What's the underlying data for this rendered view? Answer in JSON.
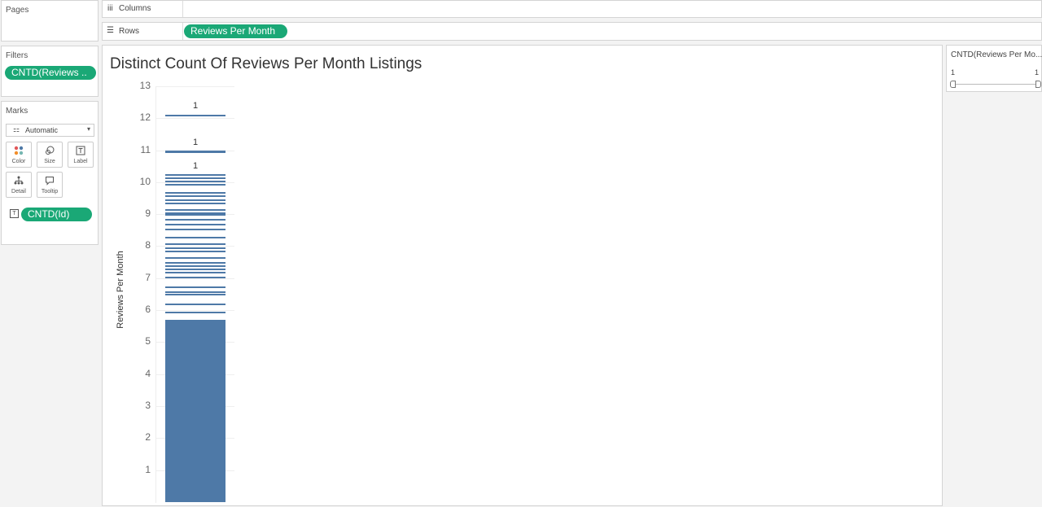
{
  "pages": {
    "title": "Pages"
  },
  "columns": {
    "icon": "iii",
    "label": "Columns"
  },
  "rows": {
    "icon": "☰",
    "label": "Rows",
    "pill": "Reviews Per Month"
  },
  "filters": {
    "title": "Filters",
    "pill": "CNTD(Reviews .."
  },
  "marks": {
    "title": "Marks",
    "dropdown": "Automatic",
    "buttons": [
      {
        "label": "Color",
        "icon": "color-icon"
      },
      {
        "label": "Size",
        "icon": "size-icon"
      },
      {
        "label": "Label",
        "icon": "label-icon"
      },
      {
        "label": "Detail",
        "icon": "detail-icon"
      },
      {
        "label": "Tooltip",
        "icon": "tooltip-icon"
      }
    ],
    "label_pill": "CNTD(Id)"
  },
  "legend": {
    "title": "CNTD(Reviews Per Mo...",
    "min": "1",
    "max": "1"
  },
  "colors": {
    "bar": "#4e79a7",
    "pill": "#1aa876"
  },
  "chart_data": {
    "type": "bar",
    "title": "Distinct Count Of Reviews Per Month Listings",
    "ylabel": "Reviews Per Month",
    "xlabel": "",
    "ylim": [
      0,
      13.2
    ],
    "yticks": [
      "1",
      "2",
      "3",
      "4",
      "5",
      "6",
      "7",
      "8",
      "9",
      "10",
      "11",
      "12",
      "13"
    ],
    "solid_segment": [
      0,
      5.7
    ],
    "stacked_segments_top": [
      5.95,
      6.2,
      6.5,
      6.6,
      6.75,
      7.05,
      7.2,
      7.3,
      7.4,
      7.5,
      7.65,
      7.85,
      7.95,
      8.1,
      8.3,
      8.55,
      8.7,
      8.85,
      9.0,
      9.05,
      9.15,
      9.35,
      9.45,
      9.6,
      9.7,
      9.95,
      10.05,
      10.15,
      10.25,
      10.95,
      11.0,
      12.1
    ],
    "data_labels": [
      {
        "value_at": 10.3,
        "text": "1"
      },
      {
        "value_at": 11.05,
        "text": "1"
      },
      {
        "value_at": 12.18,
        "text": "1"
      }
    ]
  }
}
